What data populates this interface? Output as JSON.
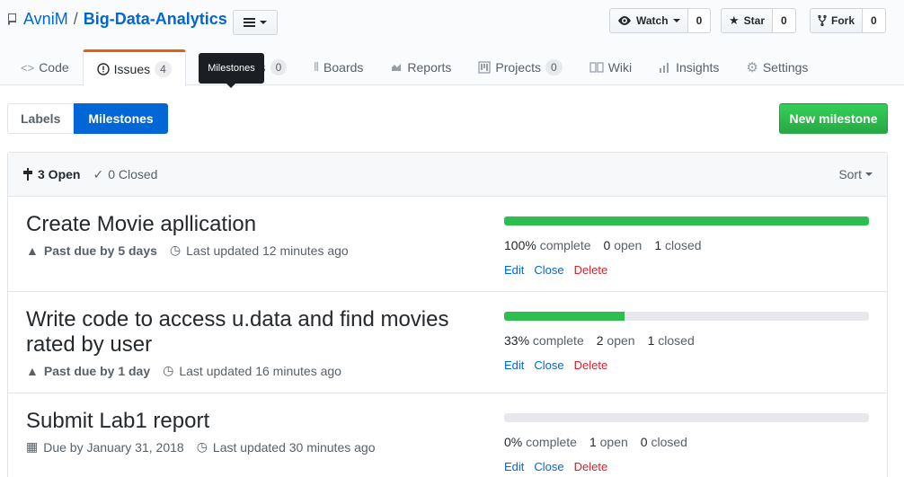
{
  "repo": {
    "owner": "AvniM",
    "separator": "/",
    "name": "Big-Data-Analytics"
  },
  "actions": {
    "watch": {
      "label": "Watch",
      "count": "0"
    },
    "star": {
      "label": "Star",
      "count": "0"
    },
    "fork": {
      "label": "Fork",
      "count": "0"
    }
  },
  "tabs": [
    {
      "label": "Code"
    },
    {
      "label": "Issues",
      "count": "4"
    },
    {
      "label": "Pull requests",
      "visible": "sts",
      "count": "0"
    },
    {
      "label": "Boards"
    },
    {
      "label": "Reports"
    },
    {
      "label": "Projects",
      "count": "0"
    },
    {
      "label": "Wiki"
    },
    {
      "label": "Insights"
    },
    {
      "label": "Settings"
    }
  ],
  "tooltip": "Milestones",
  "subnav": {
    "labels": "Labels",
    "milestones": "Milestones",
    "new_milestone": "New milestone"
  },
  "listing": {
    "open_label": "3 Open",
    "closed_label": "0 Closed",
    "sort_label": "Sort"
  },
  "milestones": [
    {
      "title": "Create Movie apllication",
      "due": "Past due by 5 days",
      "updated": "Last updated 12 minutes ago",
      "progress": 1.0,
      "complete": "100%",
      "complete_label": "complete",
      "open": "0",
      "open_label": "open",
      "closed": "1",
      "closed_label": "closed",
      "edit": "Edit",
      "close": "Close",
      "delete": "Delete"
    },
    {
      "title": "Write code to access u.data and find movies rated by user",
      "due": "Past due by 1 day",
      "updated": "Last updated 16 minutes ago",
      "progress": 0.33,
      "complete": "33%",
      "complete_label": "complete",
      "open": "2",
      "open_label": "open",
      "closed": "1",
      "closed_label": "closed",
      "edit": "Edit",
      "close": "Close",
      "delete": "Delete"
    },
    {
      "title": "Submit Lab1 report",
      "due": "Due by January 31, 2018",
      "updated": "Last updated 30 minutes ago",
      "progress": 0.0,
      "complete": "0%",
      "complete_label": "complete",
      "open": "1",
      "open_label": "open",
      "closed": "0",
      "closed_label": "closed",
      "edit": "Edit",
      "close": "Close",
      "delete": "Delete"
    }
  ],
  "colors": {
    "link": "#0366d6",
    "green": "#2cbe4e",
    "danger": "#cb2431",
    "tab_accent": "#e36209"
  }
}
